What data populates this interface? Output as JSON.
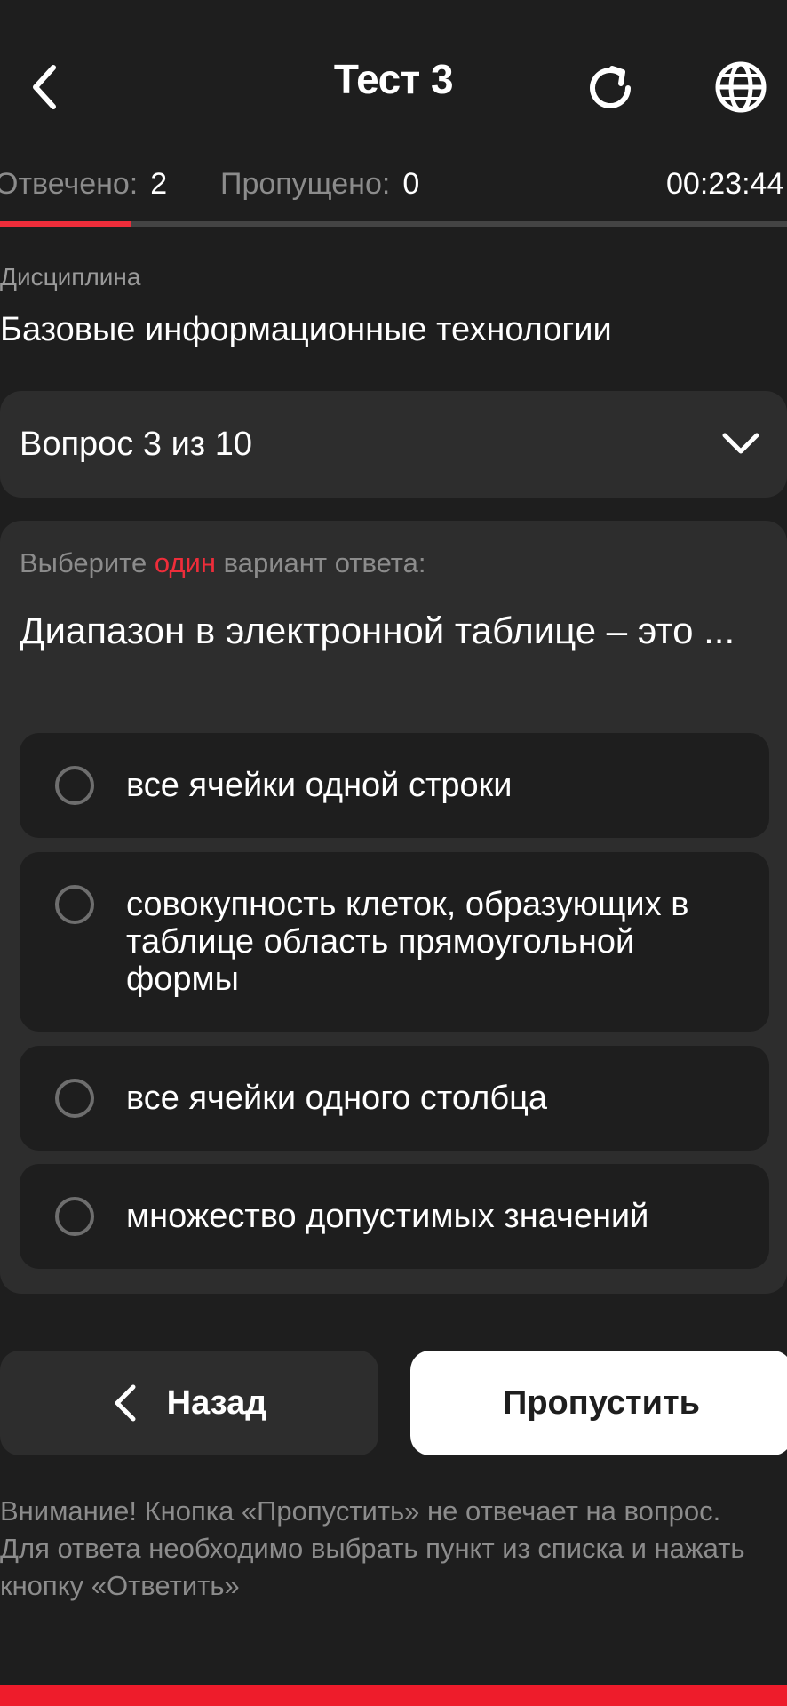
{
  "header": {
    "title": "Тест 3",
    "back_icon": "chevron-left-icon",
    "refresh_icon": "refresh-icon",
    "language_icon": "globe-icon"
  },
  "stats": {
    "answered_label": "Отвечено:",
    "answered_value": "2",
    "skipped_label": "Пропущено:",
    "skipped_value": "0",
    "timer": "00:23:44"
  },
  "progress": {
    "fraction": 0.167,
    "accent": "#ee2d3a"
  },
  "discipline": {
    "label": "Дисциплина",
    "value": "Базовые информационные технологии"
  },
  "question_select": {
    "label": "Вопрос 3 из 10",
    "icon": "chevron-down-icon"
  },
  "question": {
    "instruction_before": "Выберите",
    "instruction_accent": "один",
    "instruction_after": "вариант ответа:",
    "text": "Диапазон в электронной таблице – это ...",
    "options": [
      {
        "label": "все ячейки одной строки"
      },
      {
        "label": "совокупность клеток, образующих в таблице область прямоугольной формы"
      },
      {
        "label": "все ячейки одного столбца"
      },
      {
        "label": "множество допустимых значений"
      }
    ]
  },
  "buttons": {
    "back_label": "Назад",
    "skip_label": "Пропустить"
  },
  "warning": "Внимание! Кнопка «Пропустить» не отвечает на вопрос. Для ответа необходимо выбрать пункт из списка и нажать кнопку «Ответить»",
  "colors": {
    "background": "#1e1e1e",
    "card": "#2d2d2d",
    "accent": "#ee2d3a",
    "muted": "#8c8c8c"
  }
}
